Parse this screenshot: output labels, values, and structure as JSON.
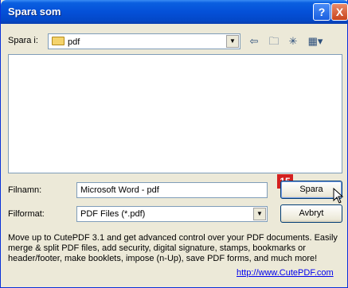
{
  "window": {
    "title": "Spara som",
    "help_label": "?",
    "close_label": "X"
  },
  "toolbar": {
    "save_in_label": "Spara i:",
    "folder_value": "pdf",
    "back_icon": "back-arrow-icon",
    "up_icon": "up-folder-icon",
    "new_folder_icon": "new-folder-icon",
    "view_icon": "view-menu-icon"
  },
  "form": {
    "filename_label": "Filnamn:",
    "filename_value": "Microsoft Word - pdf",
    "format_label": "Filformat:",
    "format_value": "PDF Files (*.pdf)",
    "save_button": "Spara",
    "cancel_button": "Avbryt"
  },
  "annotation": {
    "step_badge": "15"
  },
  "promo": {
    "text": "Move up to CutePDF 3.1 and get advanced control over your PDF documents. Easily merge & split PDF files, add security, digital signature, stamps, bookmarks or header/footer, make booklets, impose (n-Up), save PDF forms, and much more!",
    "link": "http://www.CutePDF.com"
  },
  "colors": {
    "titlebar": "#0450d8",
    "dialog_bg": "#ece9d8",
    "badge": "#d32020"
  }
}
